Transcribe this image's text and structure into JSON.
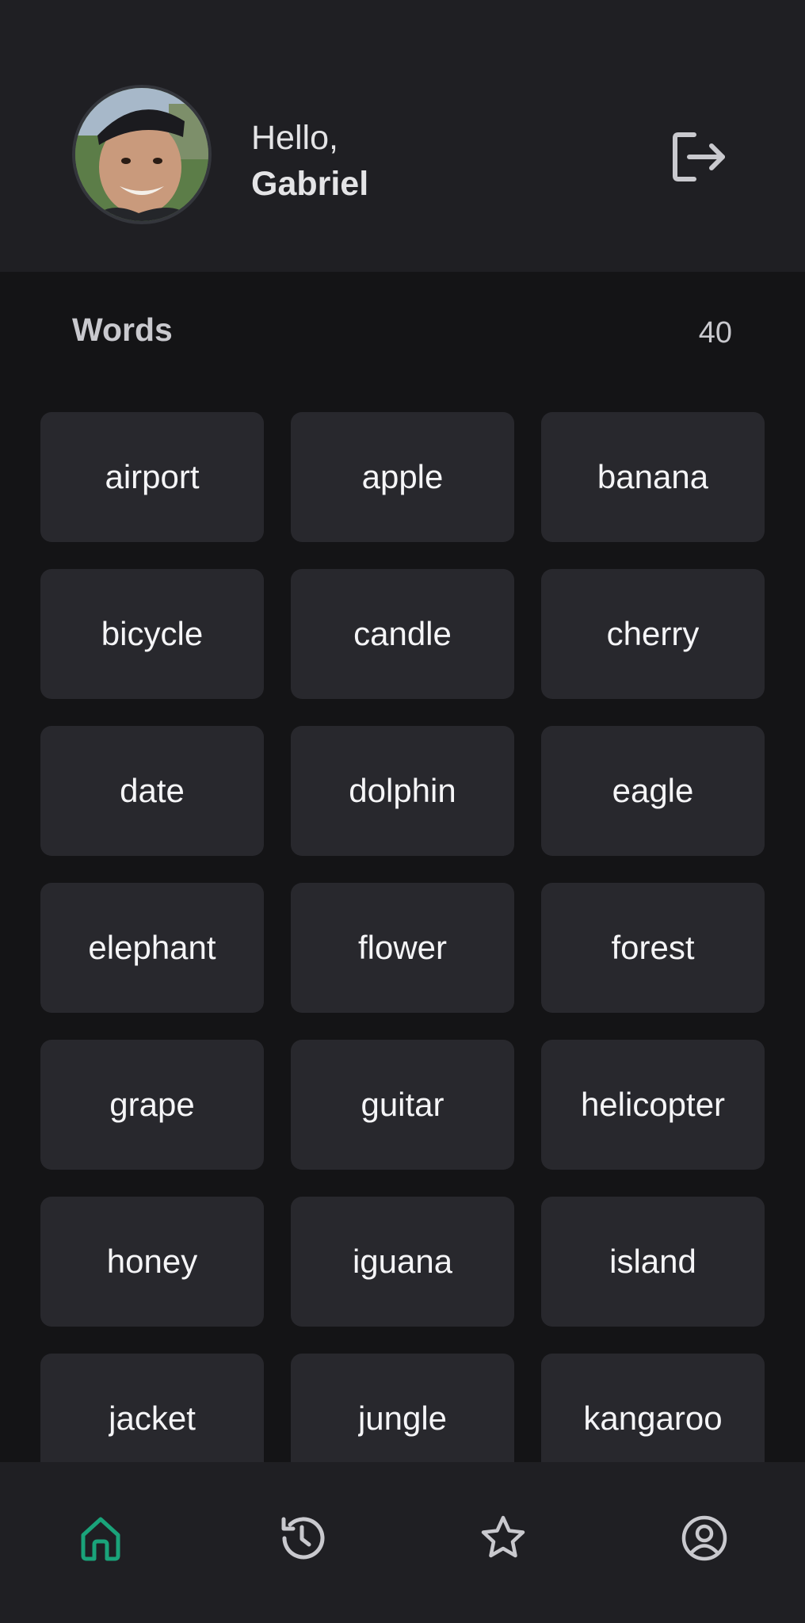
{
  "header": {
    "greeting": "Hello,",
    "user_name": "Gabriel",
    "avatar_icon": "user-photo",
    "logout_icon": "logout-icon"
  },
  "section": {
    "title": "Words",
    "count": "40"
  },
  "words": [
    "airport",
    "apple",
    "banana",
    "bicycle",
    "candle",
    "cherry",
    "date",
    "dolphin",
    "eagle",
    "elephant",
    "flower",
    "forest",
    "grape",
    "guitar",
    "helicopter",
    "honey",
    "iguana",
    "island",
    "jacket",
    "jungle",
    "kangaroo"
  ],
  "bottom_nav": {
    "items": [
      {
        "icon": "home-icon",
        "active": true
      },
      {
        "icon": "history-icon",
        "active": false
      },
      {
        "icon": "star-icon",
        "active": false
      },
      {
        "icon": "profile-icon",
        "active": false
      }
    ]
  },
  "colors": {
    "accent": "#1aa37a",
    "header_bg": "#1f1f23",
    "page_bg": "#141416",
    "card_bg": "#28282d"
  }
}
